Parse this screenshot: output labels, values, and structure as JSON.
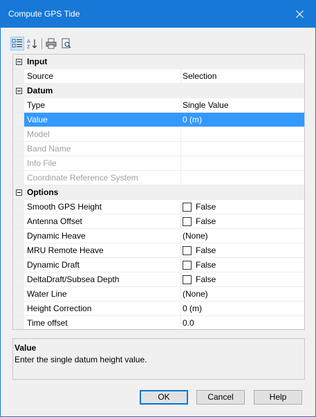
{
  "window": {
    "title": "Compute GPS Tide"
  },
  "toolbar": {
    "icons": [
      "categorized-icon",
      "alphabetical-sort-icon",
      "print-icon",
      "print-preview-icon"
    ]
  },
  "grid": {
    "input": {
      "label": "Input",
      "source": {
        "name": "Source",
        "value": "Selection"
      }
    },
    "datum": {
      "label": "Datum",
      "type": {
        "name": "Type",
        "value": "Single Value"
      },
      "value": {
        "name": "Value",
        "value": "0 (m)"
      },
      "model": {
        "name": "Model"
      },
      "band_name": {
        "name": "Band Name"
      },
      "info_file": {
        "name": "Info File"
      },
      "crs": {
        "name": "Coordinate Reference System"
      }
    },
    "options": {
      "label": "Options",
      "smooth_gps_height": {
        "name": "Smooth GPS Height",
        "value": "False",
        "checked": false
      },
      "antenna_offset": {
        "name": "Antenna Offset",
        "value": "False",
        "checked": false
      },
      "dynamic_heave": {
        "name": "Dynamic Heave",
        "value": "(None)"
      },
      "mru_remote_heave": {
        "name": "MRU Remote Heave",
        "value": "False",
        "checked": false
      },
      "dynamic_draft": {
        "name": "Dynamic Draft",
        "value": "False",
        "checked": false
      },
      "delta_draft": {
        "name": "DeltaDraft/Subsea Depth",
        "value": "False",
        "checked": false
      },
      "water_line": {
        "name": "Water Line",
        "value": "(None)"
      },
      "height_correction": {
        "name": "Height Correction",
        "value": "0 (m)"
      },
      "time_offset": {
        "name": "Time offset",
        "value": "0.0"
      }
    }
  },
  "description": {
    "title": "Value",
    "text": "Enter the single datum height value."
  },
  "buttons": {
    "ok": "OK",
    "cancel": "Cancel",
    "help": "Help"
  },
  "colors": {
    "titlebar": "#1778d8",
    "selection": "#3399ff",
    "default_button_border": "#0078d7"
  }
}
